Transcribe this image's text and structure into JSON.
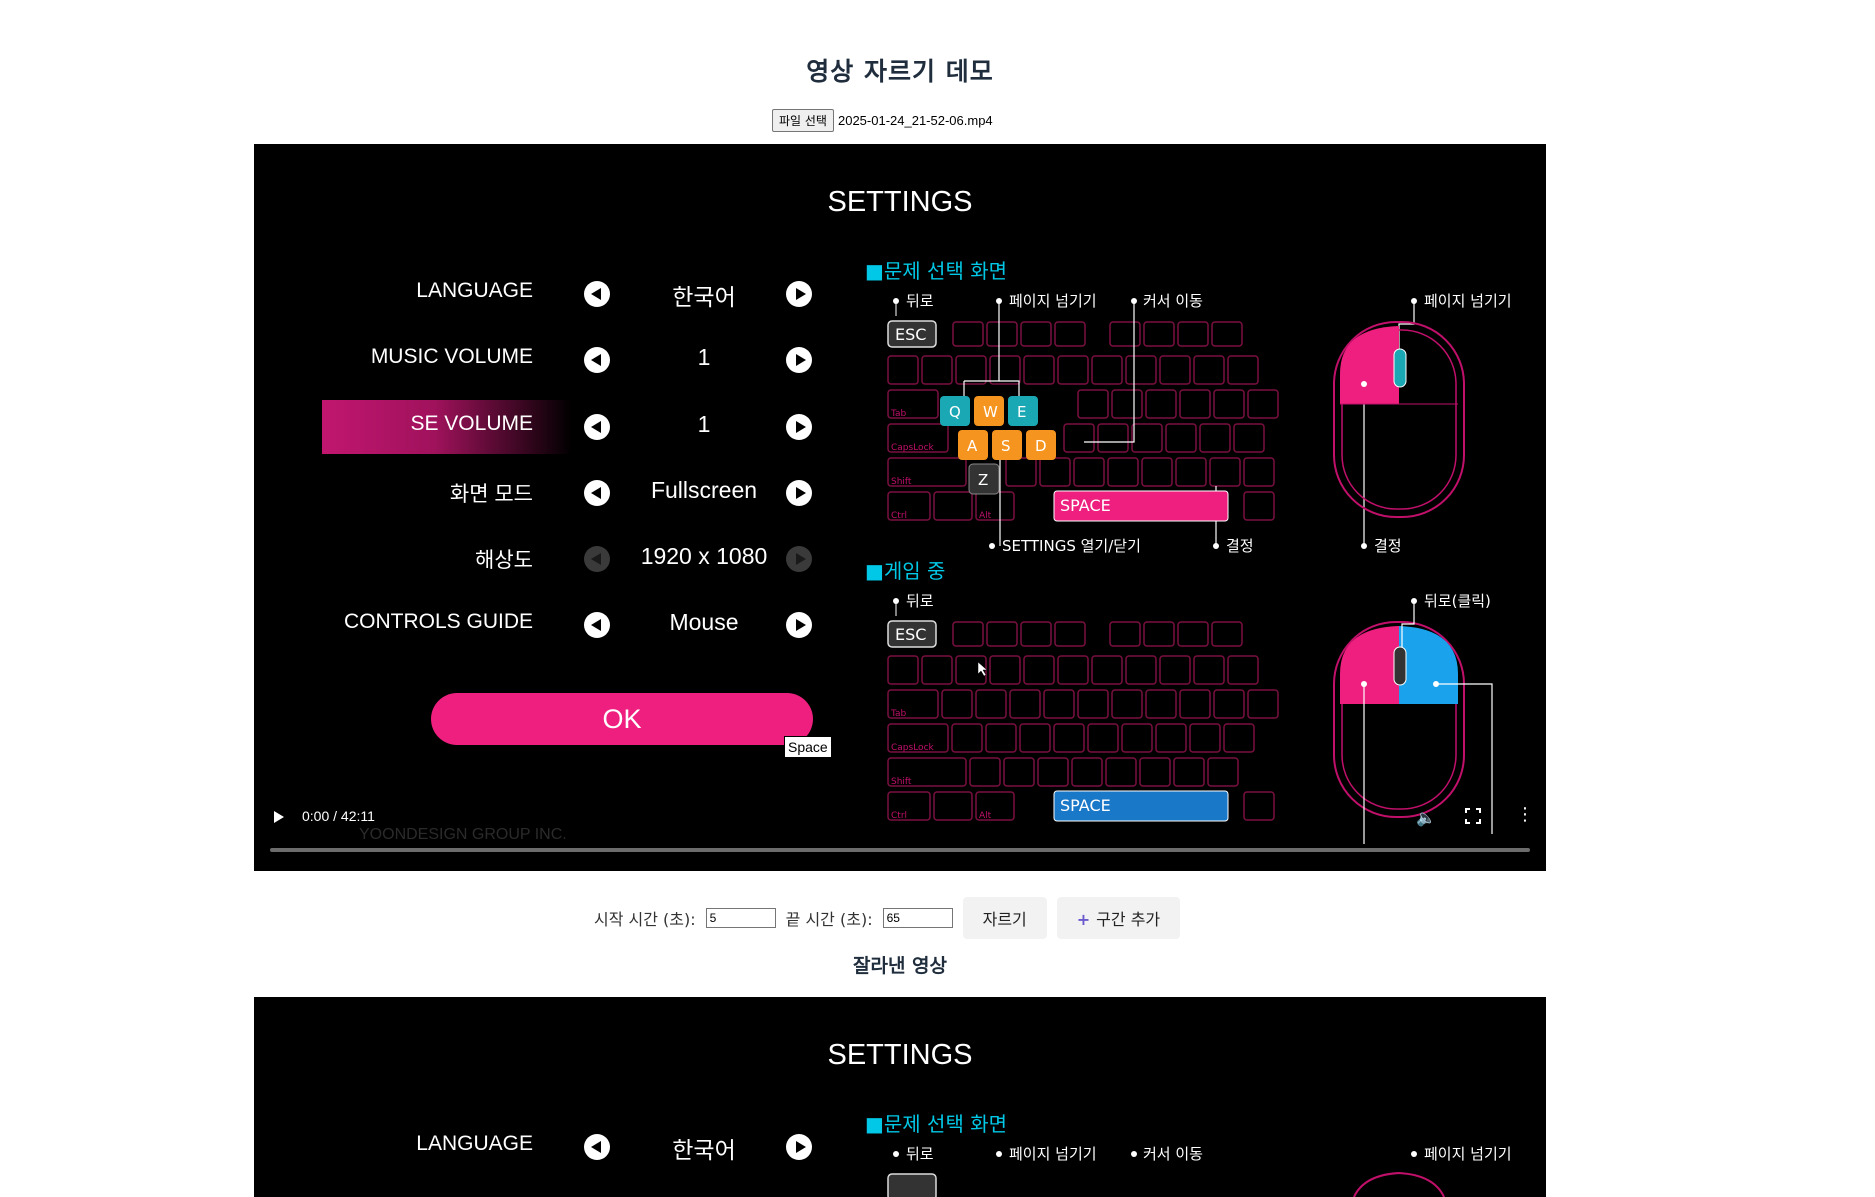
{
  "page": {
    "title": "영상 자르기 데모"
  },
  "file": {
    "button_label": "파일 선택",
    "filename": "2025-01-24_21-52-06.mp4"
  },
  "settings": {
    "title": "SETTINGS",
    "rows": [
      {
        "label": "LANGUAGE",
        "value": "한국어"
      },
      {
        "label": "MUSIC VOLUME",
        "value": "1"
      },
      {
        "label": "SE VOLUME",
        "value": "1"
      },
      {
        "label": "화면 모드",
        "value": "Fullscreen"
      },
      {
        "label": "해상도",
        "value": "1920 x 1080"
      },
      {
        "label": "CONTROLS GUIDE",
        "value": "Mouse"
      }
    ],
    "ok_label": "OK",
    "space_tag": "Space",
    "watermark": "YOONDESIGN GROUP INC."
  },
  "guide": {
    "section1": "■문제 선택 화면",
    "section2": "■게임 중",
    "back": "뒤로",
    "page_turn": "페이지 넘기기",
    "cursor_move": "커서 이동",
    "settings_toggle": "SETTINGS 열기/닫기",
    "confirm": "결정",
    "back_click": "뒤로(클릭)",
    "esc": "ESC",
    "space": "SPACE",
    "keys": [
      "Q",
      "W",
      "E",
      "A",
      "S",
      "D",
      "Z"
    ],
    "row_labels": [
      "Tab",
      "CapsLock",
      "Shift",
      "Ctrl",
      "Alt"
    ]
  },
  "player": {
    "time": "0:00 / 42:11",
    "progress": 0
  },
  "trim": {
    "start_label": "시작 시간 (초):",
    "start_value": "5",
    "end_label": "끝 시간 (초):",
    "end_value": "65",
    "cut_button": "자르기",
    "add_button": "구간 추가"
  },
  "result": {
    "title": "잘라낸 영상"
  },
  "colors": {
    "accent": "#ee1f7f",
    "guide": "#00c8e6",
    "mouse_blue": "#1aa3ec",
    "key_orange": "#f5951f",
    "key_teal": "#1ba8b5"
  }
}
